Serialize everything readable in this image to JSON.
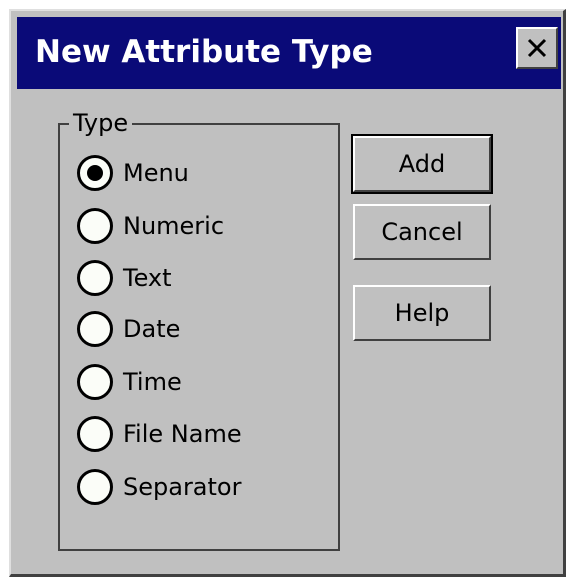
{
  "window": {
    "title": "New Attribute Type",
    "close_glyph": "✕"
  },
  "type_group": {
    "label": "Type",
    "options": [
      {
        "label": "Menu",
        "checked": true
      },
      {
        "label": "Numeric",
        "checked": false
      },
      {
        "label": "Text",
        "checked": false
      },
      {
        "label": "Date",
        "checked": false
      },
      {
        "label": "Time",
        "checked": false
      },
      {
        "label": "File Name",
        "checked": false
      },
      {
        "label": "Separator",
        "checked": false
      }
    ]
  },
  "buttons": {
    "add": "Add",
    "cancel": "Cancel",
    "help": "Help"
  },
  "colors": {
    "titlebar": "#0a0a78",
    "face": "#c0c0c0"
  }
}
